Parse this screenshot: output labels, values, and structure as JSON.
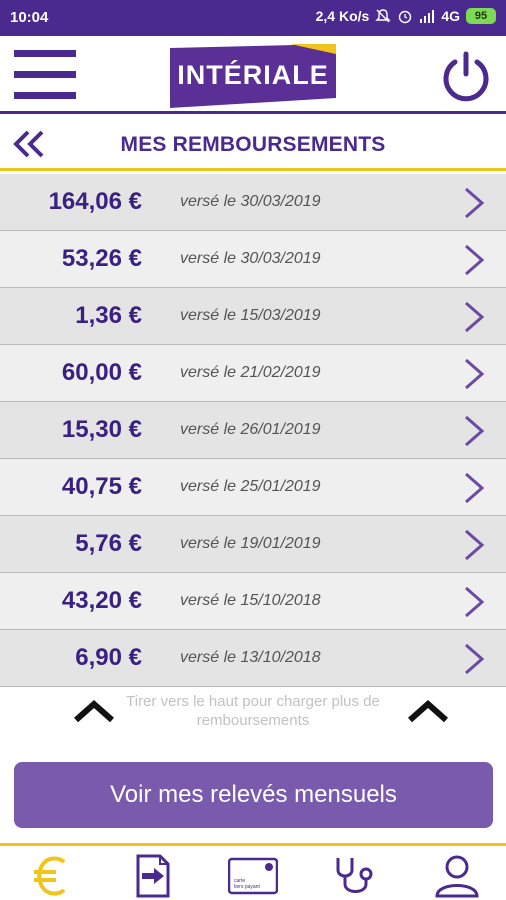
{
  "status_bar": {
    "time": "10:04",
    "speed": "2,4 Ko/s",
    "network": "4G",
    "battery": "95"
  },
  "header": {
    "logo_text": "INTÉRIALE"
  },
  "page": {
    "title": "MES REMBOURSEMENTS"
  },
  "payments": [
    {
      "amount": "164,06 €",
      "date": "versé le 30/03/2019"
    },
    {
      "amount": "53,26 €",
      "date": "versé le 30/03/2019"
    },
    {
      "amount": "1,36 €",
      "date": "versé le 15/03/2019"
    },
    {
      "amount": "60,00 €",
      "date": "versé le 21/02/2019"
    },
    {
      "amount": "15,30 €",
      "date": "versé le 26/01/2019"
    },
    {
      "amount": "40,75 €",
      "date": "versé le 25/01/2019"
    },
    {
      "amount": "5,76 €",
      "date": "versé le 19/01/2019"
    },
    {
      "amount": "43,20 €",
      "date": "versé le 15/10/2018"
    },
    {
      "amount": "6,90 €",
      "date": "versé le 13/10/2018"
    }
  ],
  "pull_hint": "Tirer vers le haut pour charger plus de remboursements",
  "cta_label": "Voir mes relevés mensuels",
  "nav": {
    "items": [
      "euro-icon",
      "document-arrow-icon",
      "card-icon",
      "stethoscope-icon",
      "profile-icon"
    ],
    "card_text_1": "carte",
    "card_text_2": "tiers payant"
  },
  "colors": {
    "brand_purple": "#4a2a8f",
    "button_purple": "#7a5aad",
    "accent_yellow": "#f0c419"
  }
}
